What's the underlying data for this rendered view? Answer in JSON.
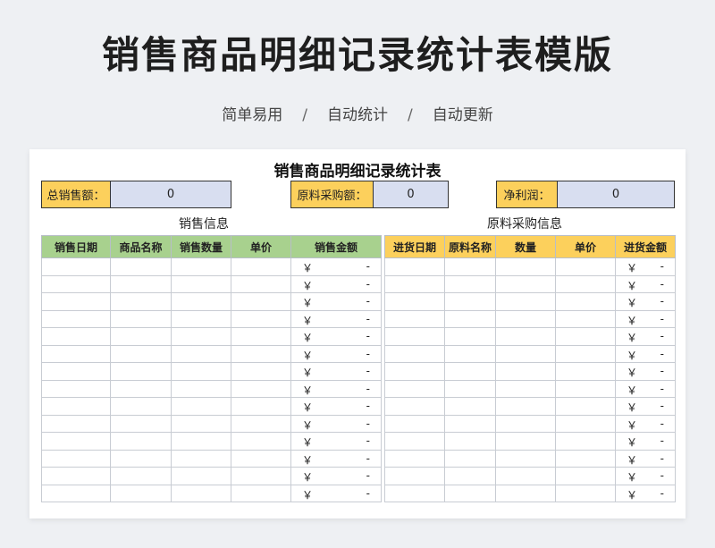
{
  "hero": {
    "title": "销售商品明细记录统计表模版",
    "tags": [
      "简单易用",
      "自动统计",
      "自动更新"
    ],
    "separator": "/"
  },
  "sheet": {
    "title": "销售商品明细记录统计表",
    "summary": [
      {
        "label": "总销售额：",
        "value": "0"
      },
      {
        "label": "原料采购额：",
        "value": "0"
      },
      {
        "label": "净利润：",
        "value": "0"
      }
    ],
    "sales": {
      "section_title": "销售信息",
      "headers": [
        "销售日期",
        "商品名称",
        "销售数量",
        "单价",
        "销售金额"
      ]
    },
    "purchase": {
      "section_title": "原料采购信息",
      "headers": [
        "进货日期",
        "原料名称",
        "数量",
        "单价",
        "进货金额"
      ]
    },
    "money_cell": {
      "currency": "￥",
      "empty": "-"
    }
  },
  "colors": {
    "green_header": "#a8d18e",
    "yellow_header": "#fcd05c",
    "value_fill": "#d8def0"
  }
}
